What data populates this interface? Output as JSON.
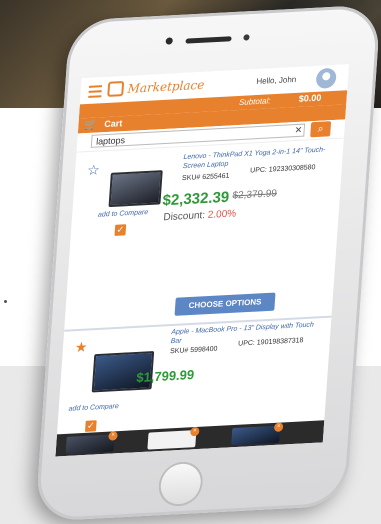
{
  "header": {
    "brand": "Marketplace",
    "greeting": "Hello, John"
  },
  "cart_bar": {
    "subtotal_label": "Subtotal:",
    "subtotal_value": "$0.00",
    "cart_label": "Cart"
  },
  "search": {
    "value": "laptops",
    "clear_icon": "✕",
    "search_icon": "⌕"
  },
  "products": [
    {
      "title": "Lenovo - ThinkPad X1 Yoga 2-in-1 14\" Touch-Screen Laptop",
      "sku": "SKU# 6255461",
      "upc": "UPC: 192330308580",
      "price": "$2,332.39",
      "old_price": "$2,379.99",
      "discount_label": "Discount:",
      "discount_value": "2.00%",
      "compare_label": "add to Compare",
      "favorite_icon": "☆"
    },
    {
      "title": "Apple - MacBook Pro - 13\" Display with Touch Bar",
      "sku": "SKU# 5998400",
      "upc": "UPC: 190198387318",
      "price": "$1,799.99",
      "compare_label": "add to Compare",
      "favorite_icon": "★"
    }
  ],
  "choose_options_label": "CHOOSE OPTIONS",
  "checkbox_mark": "✓",
  "tray_badge": "×",
  "colors": {
    "accent": "#e8812d",
    "link_blue": "#3f67a8",
    "price_green": "#2e9a3a",
    "discount_red": "#e0524a",
    "button_blue": "#5c86c4"
  }
}
